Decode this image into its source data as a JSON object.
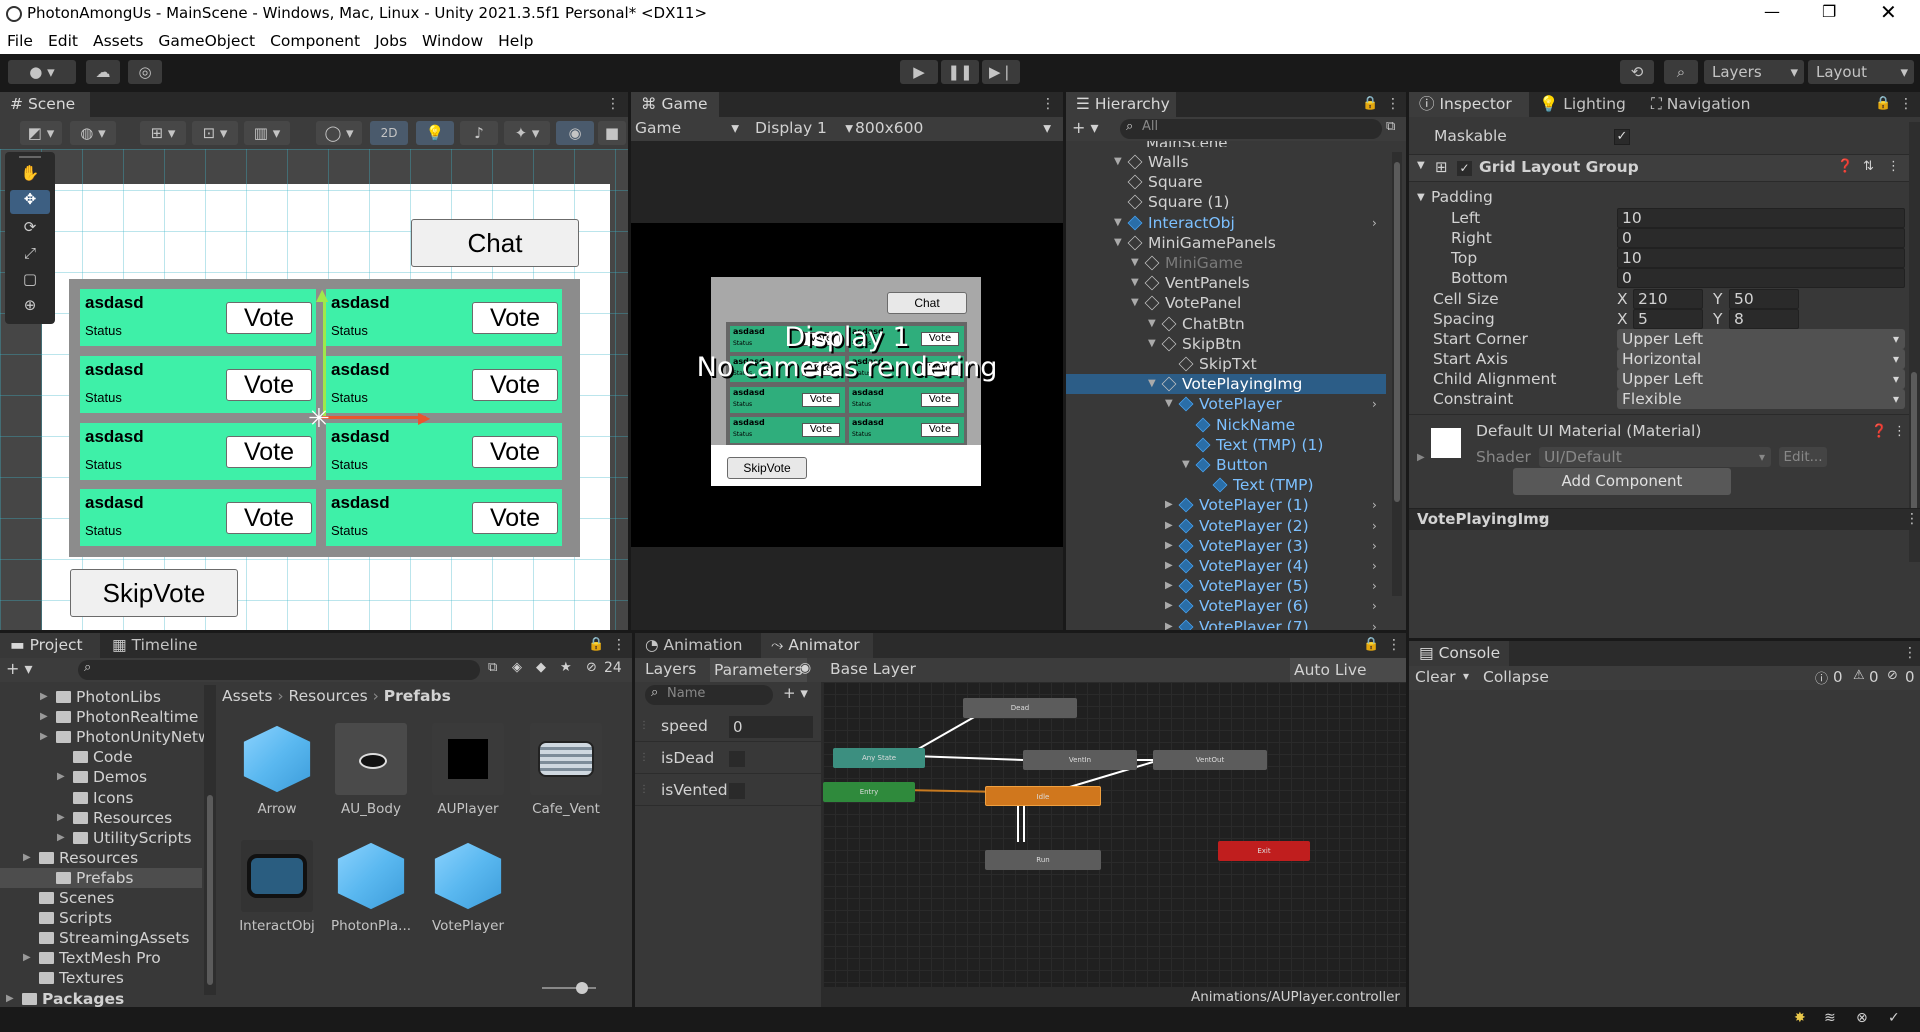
{
  "window": {
    "title": "PhotonAmongUs - MainScene - Windows, Mac, Linux - Unity 2021.3.5f1 Personal* <DX11>"
  },
  "menu": [
    "File",
    "Edit",
    "Assets",
    "GameObject",
    "Component",
    "Jobs",
    "Window",
    "Help"
  ],
  "toolbar": {
    "layers_label": "Layers",
    "layout_label": "Layout"
  },
  "scene": {
    "tab": "Scene",
    "mode_2d": "2D",
    "chat_label": "Chat",
    "skip_label": "SkipVote",
    "cells": [
      {
        "name": "asdasd",
        "status": "Status",
        "vote": "Vote"
      },
      {
        "name": "asdasd",
        "status": "Status",
        "vote": "Vote"
      },
      {
        "name": "asdasd",
        "status": "Status",
        "vote": "Vote"
      },
      {
        "name": "asdasd",
        "status": "Status",
        "vote": "Vote"
      },
      {
        "name": "asdasd",
        "status": "Status",
        "vote": "Vote"
      },
      {
        "name": "asdasd",
        "status": "Status",
        "vote": "Vote"
      },
      {
        "name": "asdasd",
        "status": "Status",
        "vote": "Vote"
      },
      {
        "name": "asdasd",
        "status": "Status",
        "vote": "Vote"
      }
    ]
  },
  "game": {
    "tab": "Game",
    "mode": "Game",
    "display": "Display 1",
    "resolution": "800x600",
    "overlay_line1": "Display 1",
    "overlay_line2": "No cameras rendering",
    "chat": "Chat",
    "skip": "SkipVote",
    "mini_name": "asdasd",
    "mini_status": "Status",
    "mini_vote": "Vote"
  },
  "hierarchy": {
    "tab": "Hierarchy",
    "search_placeholder": "All",
    "rows": [
      {
        "label": "Walls",
        "indent": 0,
        "arrow": true,
        "blue": false
      },
      {
        "label": "Square",
        "indent": 0,
        "arrow": false,
        "blue": false
      },
      {
        "label": "Square (1)",
        "indent": 0,
        "arrow": false,
        "blue": false
      },
      {
        "label": "InteractObj",
        "indent": 0,
        "arrow": true,
        "blue": true
      },
      {
        "label": "MiniGamePanels",
        "indent": 0,
        "arrow": true,
        "blue": false
      },
      {
        "label": "MiniGame",
        "indent": 1,
        "arrow": true,
        "blue": false,
        "dim": true
      },
      {
        "label": "VentPanels",
        "indent": 1,
        "arrow": true,
        "blue": false
      },
      {
        "label": "VotePanel",
        "indent": 1,
        "arrow": true,
        "blue": false
      },
      {
        "label": "ChatBtn",
        "indent": 2,
        "arrow": true,
        "blue": false
      },
      {
        "label": "SkipBtn",
        "indent": 2,
        "arrow": true,
        "blue": false
      },
      {
        "label": "SkipTxt",
        "indent": 3,
        "arrow": false,
        "blue": false
      },
      {
        "label": "VotePlayingImg",
        "indent": 2,
        "arrow": true,
        "blue": false,
        "selected": true
      },
      {
        "label": "VotePlayer",
        "indent": 3,
        "arrow": true,
        "blue": true
      },
      {
        "label": "NickName",
        "indent": 4,
        "arrow": false,
        "blue": true
      },
      {
        "label": "Text (TMP) (1)",
        "indent": 4,
        "arrow": false,
        "blue": true
      },
      {
        "label": "Button",
        "indent": 4,
        "arrow": true,
        "blue": true
      },
      {
        "label": "Text (TMP)",
        "indent": 5,
        "arrow": false,
        "blue": true
      },
      {
        "label": "VotePlayer (1)",
        "indent": 3,
        "arrow": true,
        "blue": true
      },
      {
        "label": "VotePlayer (2)",
        "indent": 3,
        "arrow": true,
        "blue": true
      },
      {
        "label": "VotePlayer (3)",
        "indent": 3,
        "arrow": true,
        "blue": true
      },
      {
        "label": "VotePlayer (4)",
        "indent": 3,
        "arrow": true,
        "blue": true
      },
      {
        "label": "VotePlayer (5)",
        "indent": 3,
        "arrow": true,
        "blue": true
      },
      {
        "label": "VotePlayer (6)",
        "indent": 3,
        "arrow": true,
        "blue": true
      },
      {
        "label": "VotePlayer (7)",
        "indent": 3,
        "arrow": true,
        "blue": true
      }
    ]
  },
  "inspector": {
    "tabs": [
      "Inspector",
      "Lighting",
      "Navigation"
    ],
    "maskable": "Maskable",
    "component": "Grid Layout Group",
    "padding": "Padding",
    "left_label": "Left",
    "left": "10",
    "right_label": "Right",
    "right": "0",
    "top_label": "Top",
    "top": "10",
    "bottom_label": "Bottom",
    "bottom": "0",
    "cell_size": "Cell Size",
    "cell_x": "210",
    "cell_y": "50",
    "spacing": "Spacing",
    "spacing_x": "5",
    "spacing_y": "8",
    "x": "X",
    "y": "Y",
    "start_corner": "Start Corner",
    "start_corner_val": "Upper Left",
    "start_axis": "Start Axis",
    "start_axis_val": "Horizontal",
    "child_alignment": "Child Alignment",
    "child_alignment_val": "Upper Left",
    "constraint": "Constraint",
    "constraint_val": "Flexible",
    "material": "Default UI Material (Material)",
    "shader_label": "Shader",
    "shader_val": "UI/Default",
    "edit": "Edit...",
    "add_component": "Add Component",
    "footer": "VotePlayingImg"
  },
  "project": {
    "tabs": [
      "Project",
      "Timeline"
    ],
    "hidden_count": "24",
    "breadcrumb": [
      "Assets",
      "Resources",
      "Prefabs"
    ],
    "tree": [
      {
        "label": "PhotonLibs",
        "indent": 2
      },
      {
        "label": "PhotonRealtime",
        "indent": 2
      },
      {
        "label": "PhotonUnityNetw",
        "indent": 2
      },
      {
        "label": "Code",
        "indent": 3
      },
      {
        "label": "Demos",
        "indent": 3
      },
      {
        "label": "Icons",
        "indent": 3
      },
      {
        "label": "Resources",
        "indent": 3
      },
      {
        "label": "UtilityScripts",
        "indent": 3
      },
      {
        "label": "Resources",
        "indent": 1
      },
      {
        "label": "Prefabs",
        "indent": 2,
        "selected": true
      },
      {
        "label": "Scenes",
        "indent": 1
      },
      {
        "label": "Scripts",
        "indent": 1
      },
      {
        "label": "StreamingAssets",
        "indent": 1
      },
      {
        "label": "TextMesh Pro",
        "indent": 1
      },
      {
        "label": "Textures",
        "indent": 1
      },
      {
        "label": "Packages",
        "indent": 0,
        "bold": true
      }
    ],
    "assets": [
      "Arrow",
      "AU_Body",
      "AUPlayer",
      "Cafe_Vent",
      "InteractObj",
      "PhotonPla...",
      "VotePlayer"
    ]
  },
  "animator": {
    "tabs": [
      "Animation",
      "Animator"
    ],
    "layers": "Layers",
    "parameters": "Parameters",
    "base_layer": "Base Layer",
    "auto_live": "Auto Live Link",
    "search_placeholder": "Name",
    "params": [
      {
        "name": "speed",
        "value": "0"
      },
      {
        "name": "isDead",
        "value": ""
      },
      {
        "name": "isVented",
        "value": ""
      }
    ],
    "nodes": [
      "Dead",
      "Any State",
      "VentIn",
      "VentOut",
      "Entry",
      "Idle",
      "Run",
      "Exit"
    ],
    "path": "Animations/AUPlayer.controller"
  },
  "console": {
    "tab": "Console",
    "clear": "Clear",
    "collapse": "Collapse",
    "count_log": "0",
    "count_warn": "0",
    "count_err": "0"
  }
}
